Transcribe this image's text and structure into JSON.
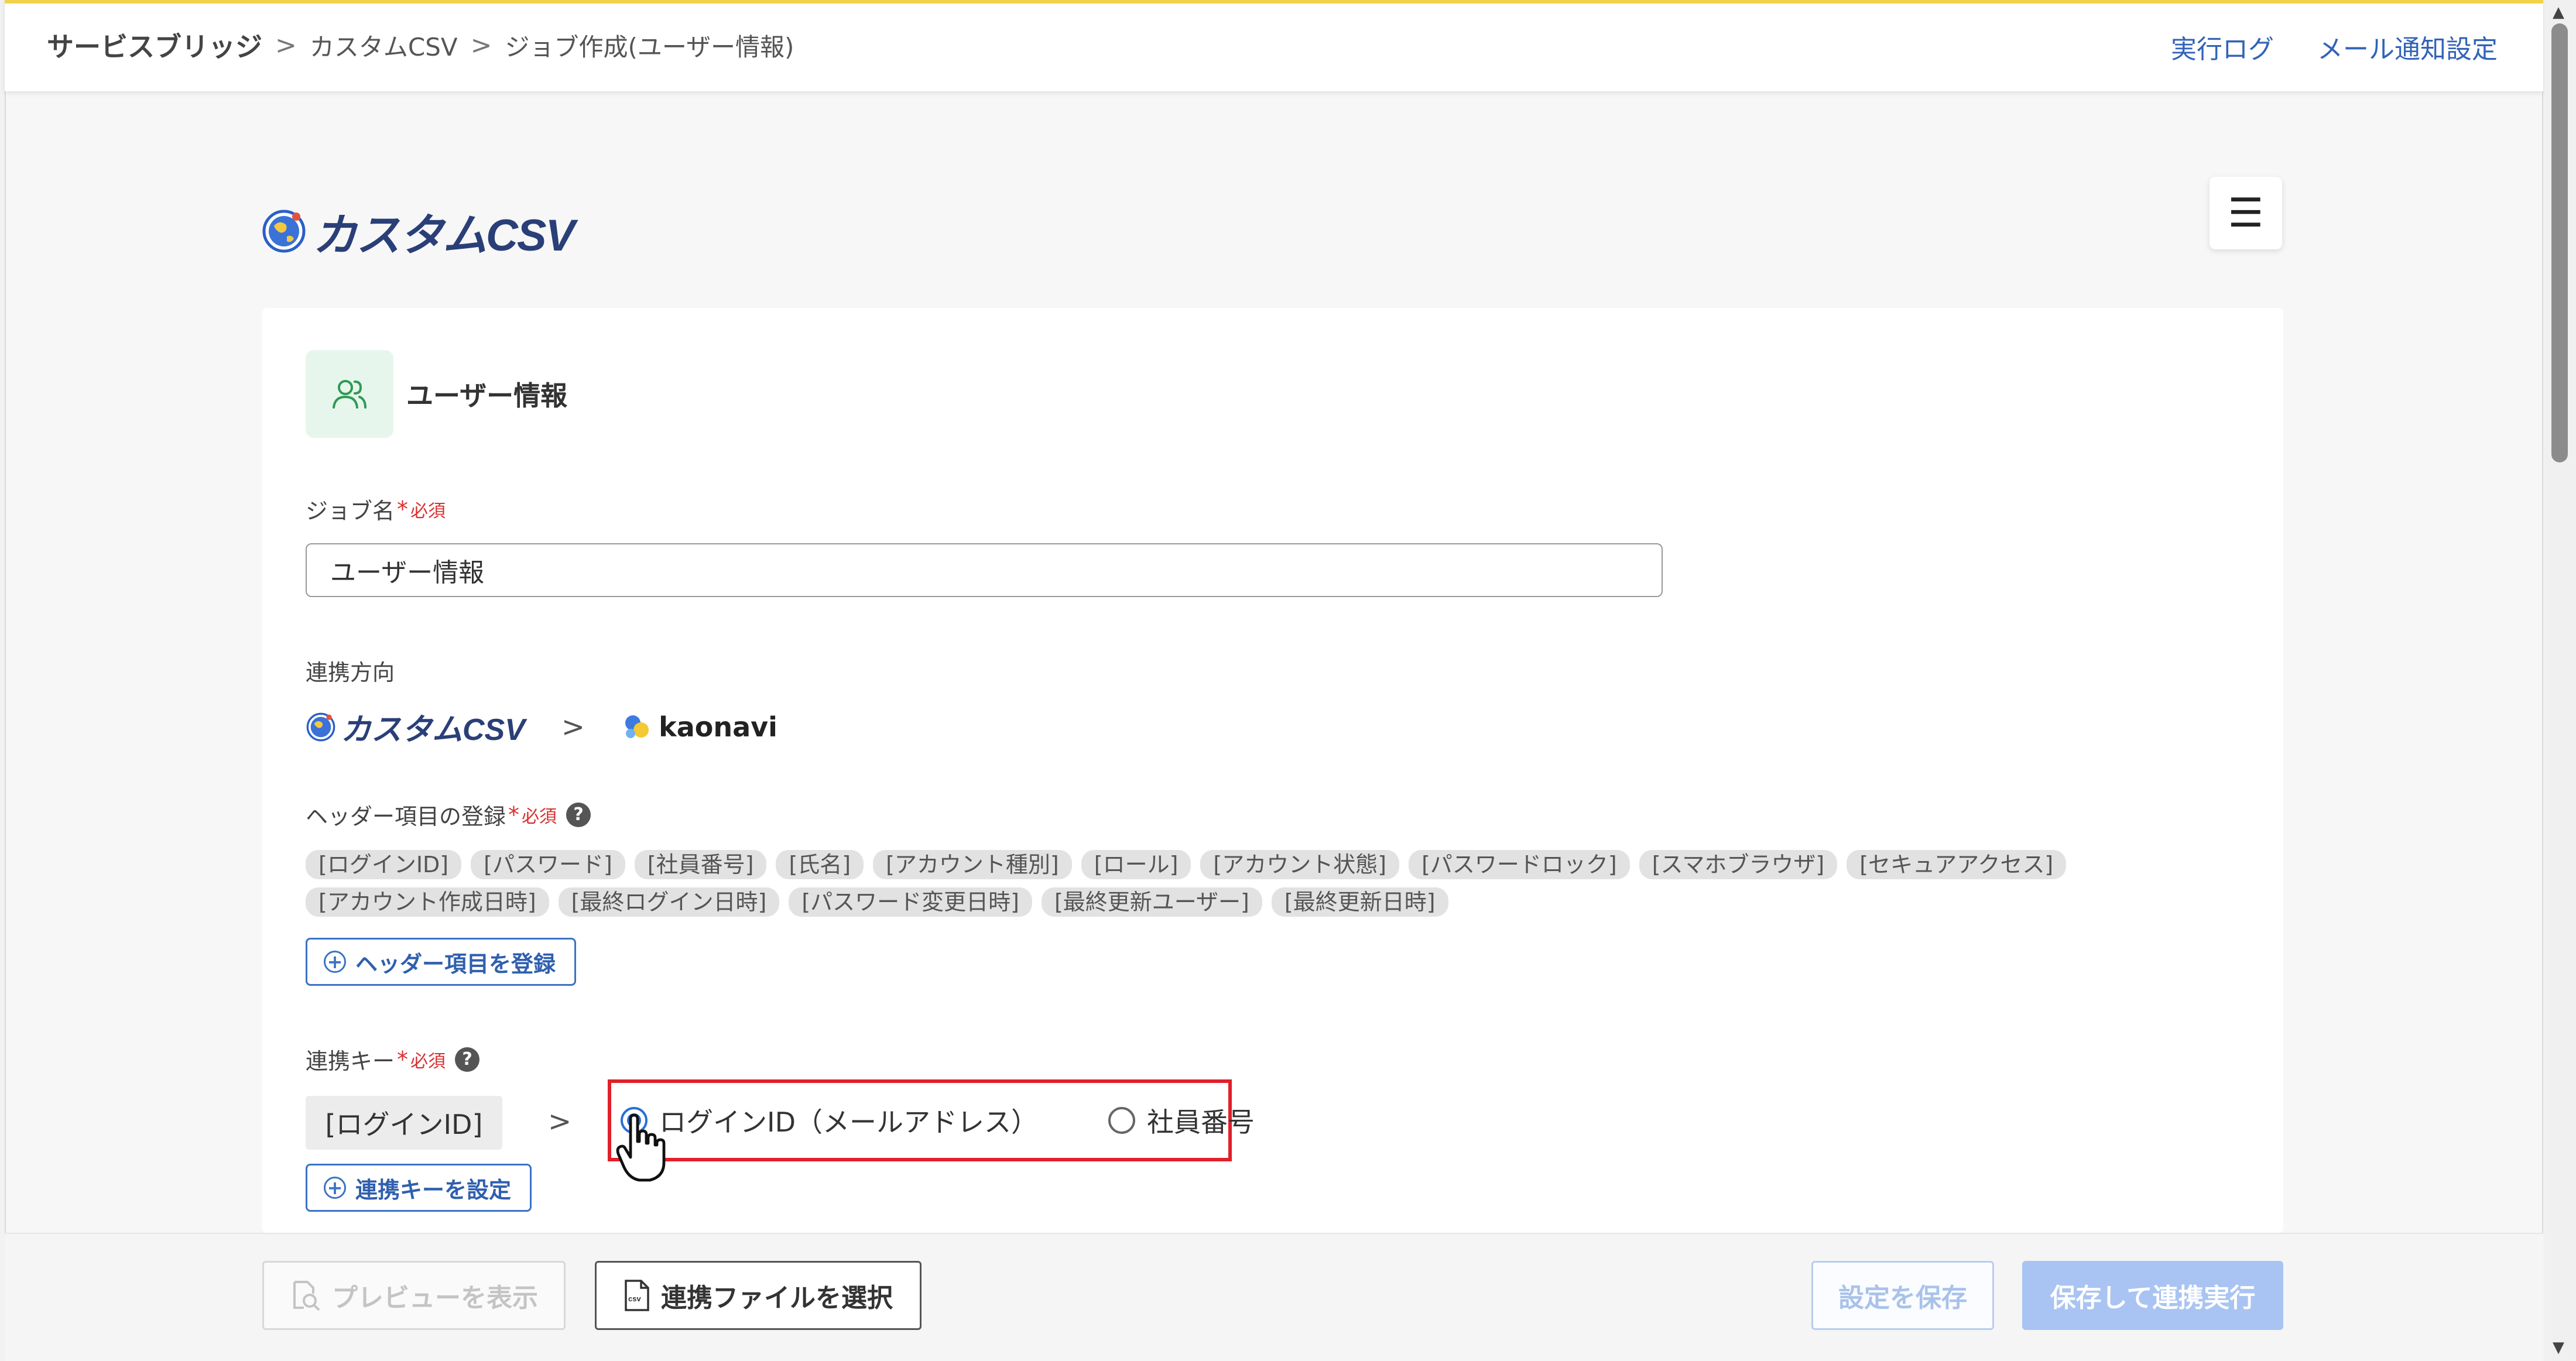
{
  "breadcrumb": {
    "items": [
      "サービスブリッジ",
      "カスタムCSV",
      "ジョブ作成(ユーザー情報)"
    ],
    "separator": ">"
  },
  "header_links": {
    "execution_log": "実行ログ",
    "mail_settings": "メール通知設定"
  },
  "logo": {
    "text": "カスタムCSV"
  },
  "menu": {
    "icon": "hamburger-icon",
    "glyph": "☰"
  },
  "job": {
    "icon": "users-icon",
    "title": "ユーザー情報"
  },
  "job_name": {
    "label": "ジョブ名",
    "star": "*",
    "required": "必須",
    "value": "ユーザー情報"
  },
  "direction": {
    "label": "連携方向",
    "source": "カスタムCSV",
    "arrow": ">",
    "target": "kaonavi"
  },
  "headers": {
    "label": "ヘッダー項目の登録",
    "star": "*",
    "required": "必須",
    "help": "?",
    "chips": [
      "[ログインID]",
      "[パスワード]",
      "[社員番号]",
      "[氏名]",
      "[アカウント種別]",
      "[ロール]",
      "[アカウント状態]",
      "[パスワードロック]",
      "[スマホブラウザ]",
      "[セキュアアクセス]",
      "[アカウント作成日時]",
      "[最終ログイン日時]",
      "[パスワード変更日時]",
      "[最終更新ユーザー]",
      "[最終更新日時]"
    ],
    "register_button": "ヘッダー項目を登録",
    "plus": "+"
  },
  "link_key": {
    "label": "連携キー",
    "star": "*",
    "required": "必須",
    "help": "?",
    "source_field": "[ログインID]",
    "arrow": ">",
    "options": [
      {
        "label": "ログインID（メールアドレス）",
        "selected": true
      },
      {
        "label": "社員番号",
        "selected": false
      }
    ],
    "set_button": "連携キーを設定",
    "plus": "+"
  },
  "footer": {
    "preview": "プレビューを表示",
    "select_file": "連携ファイルを選択",
    "save": "設定を保存",
    "save_and_run": "保存して連携実行"
  },
  "colors": {
    "accent_blue": "#3b73c4",
    "highlight_red": "#e0202a",
    "top_border": "#f2d24a",
    "logo_navy": "#2a3f78"
  }
}
